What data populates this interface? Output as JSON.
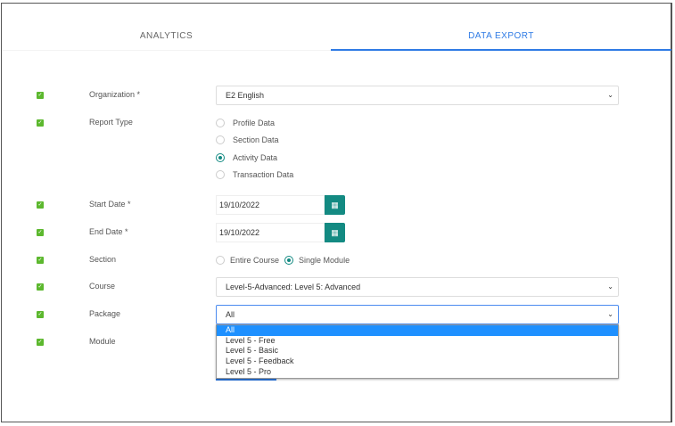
{
  "tabs": [
    {
      "label": "ANALYTICS",
      "active": false
    },
    {
      "label": "DATA EXPORT",
      "active": true
    }
  ],
  "colors": {
    "accent": "#2f7be5",
    "teal": "#138a82",
    "check": "#5cb82e"
  },
  "form": {
    "organization": {
      "label": "Organization *",
      "value": "E2 English"
    },
    "report_type": {
      "label": "Report Type",
      "options": [
        "Profile Data",
        "Section Data",
        "Activity Data",
        "Transaction Data"
      ],
      "selected": "Activity Data"
    },
    "start_date": {
      "label": "Start Date *",
      "value": "19/10/2022"
    },
    "end_date": {
      "label": "End Date *",
      "value": "19/10/2022"
    },
    "section": {
      "label": "Section",
      "options": [
        "Entire Course",
        "Single Module"
      ],
      "selected": "Single Module"
    },
    "course": {
      "label": "Course",
      "value": "Level-5-Advanced: Level 5: Advanced"
    },
    "package": {
      "label": "Package",
      "value": "All",
      "options": [
        "All",
        "Level 5 - Free",
        "Level 5 - Basic",
        "Level 5 - Feedback",
        "Level 5 - Pro"
      ]
    },
    "module": {
      "label": "Module"
    }
  }
}
